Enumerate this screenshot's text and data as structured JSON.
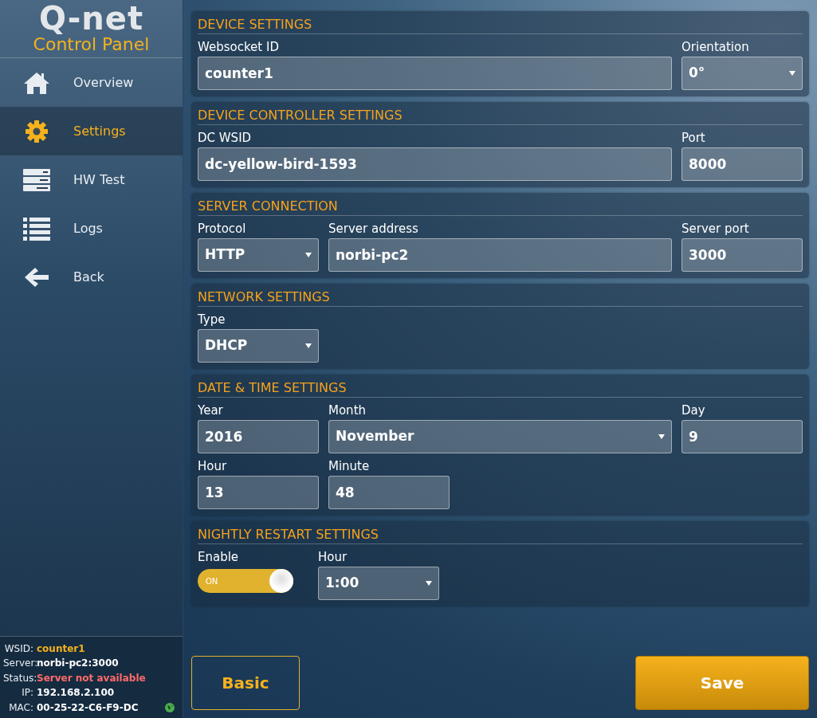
{
  "logo": {
    "brand": "Q-net",
    "subtitle": "Control Panel"
  },
  "nav": [
    {
      "label": "Overview",
      "selected": false
    },
    {
      "label": "Settings",
      "selected": true
    },
    {
      "label": "HW Test",
      "selected": false
    },
    {
      "label": "Logs",
      "selected": false
    },
    {
      "label": "Back",
      "selected": false
    }
  ],
  "status": [
    {
      "label": "WSID:",
      "value": "counter1",
      "color": "#f6b21c"
    },
    {
      "label": "Server:",
      "value": "norbi-pc2:3000",
      "color": "#ffffff"
    },
    {
      "label": "Status:",
      "value": "Server not available",
      "color": "#ff6b6b"
    },
    {
      "label": "IP:",
      "value": "192.168.2.100",
      "color": "#ffffff"
    },
    {
      "label": "MAC:",
      "value": "00-25-22-C6-F9-DC",
      "color": "#ffffff"
    }
  ],
  "sections": [
    {
      "title": "DEVICE SETTINGS",
      "rows": [
        [
          {
            "label": "Websocket ID",
            "kind": "text",
            "value": "counter1",
            "wide": true
          },
          {
            "label": "Orientation",
            "kind": "select",
            "value": "0°",
            "wide": false
          }
        ]
      ]
    },
    {
      "title": "DEVICE CONTROLLER SETTINGS",
      "rows": [
        [
          {
            "label": "DC WSID",
            "kind": "text",
            "value": "dc-yellow-bird-1593",
            "wide": true
          },
          {
            "label": "Port",
            "kind": "text",
            "value": "8000",
            "wide": false
          }
        ]
      ]
    },
    {
      "title": "SERVER CONNECTION",
      "rows": [
        [
          {
            "label": "Protocol",
            "kind": "select",
            "value": "HTTP",
            "wide": false
          },
          {
            "label": "Server address",
            "kind": "text",
            "value": "norbi-pc2",
            "wide": true
          },
          {
            "label": "Server port",
            "kind": "text",
            "value": "3000",
            "wide": false
          }
        ]
      ]
    },
    {
      "title": "NETWORK SETTINGS",
      "rows": [
        [
          {
            "label": "Type",
            "kind": "select",
            "value": "DHCP",
            "wide": false
          }
        ]
      ]
    },
    {
      "title": "DATE & TIME SETTINGS",
      "rows": [
        [
          {
            "label": "Year",
            "kind": "text",
            "value": "2016",
            "wide": false
          },
          {
            "label": "Month",
            "kind": "select",
            "value": "November",
            "wide": true
          },
          {
            "label": "Day",
            "kind": "text",
            "value": "9",
            "wide": false
          }
        ],
        [
          {
            "label": "Hour",
            "kind": "text",
            "value": "13",
            "wide": false
          },
          {
            "label": "Minute",
            "kind": "text",
            "value": "48",
            "wide": false
          }
        ]
      ]
    },
    {
      "title": "NIGHTLY RESTART SETTINGS",
      "rows": [
        [
          {
            "label": "Enable",
            "kind": "toggle",
            "on": true,
            "text": "ON"
          },
          {
            "label": "Hour",
            "kind": "select",
            "value": "1:00",
            "wide": false
          }
        ]
      ]
    }
  ],
  "buttons": [
    {
      "label": "Basic",
      "kind": "outline"
    },
    {
      "label": "Save",
      "kind": "primary"
    }
  ]
}
